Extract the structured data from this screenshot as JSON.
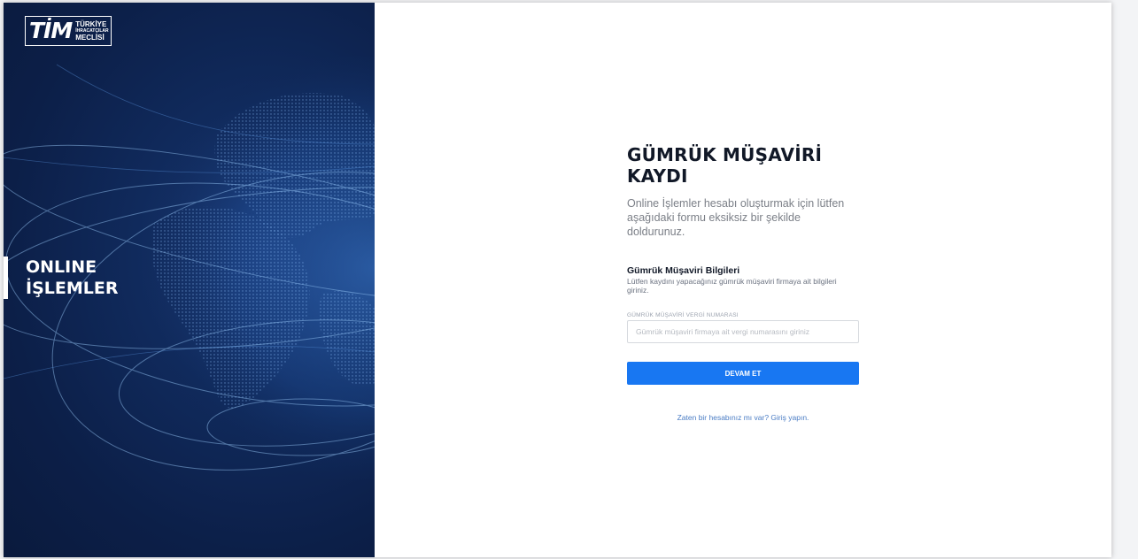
{
  "brand": {
    "logo_mark": "TİM",
    "logo_line1": "TÜRKİYE",
    "logo_line2": "İHRACATÇILAR",
    "logo_line3": "MECLİSİ"
  },
  "hero": {
    "title_line1": "ONLINE",
    "title_line2": "İŞLEMLER"
  },
  "form": {
    "title_line1": "GÜMRÜK MÜŞAVİRİ",
    "title_line2": "KAYDI",
    "intro": "Online İşlemler hesabı oluşturmak için lütfen aşağıdaki formu eksiksiz bir şekilde doldurunuz.",
    "section_title": "Gümrük Müşaviri Bilgileri",
    "section_desc": "Lütfen kaydını yapacağınız gümrük müşaviri firmaya ait bilgileri giriniz.",
    "tax_field": {
      "label": "GÜMRÜK MÜŞAVİRİ VERGİ NUMARASI",
      "value": "",
      "placeholder": "Gümrük müşaviri firmaya ait vergi numarasını giriniz"
    },
    "continue_label": "DEVAM ET",
    "login_link": "Zaten bir hesabınız mı var? Giriş yapın."
  },
  "colors": {
    "hero_background": "#0c1f48",
    "accent": "#1877f2",
    "link": "#4a7cc4"
  }
}
